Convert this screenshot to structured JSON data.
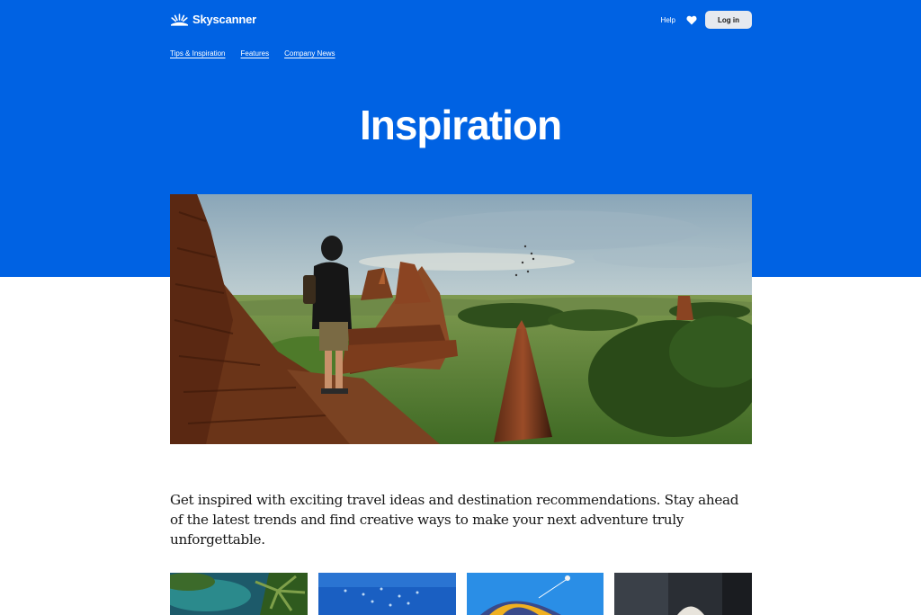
{
  "header": {
    "brand": "Skyscanner",
    "help_label": "Help",
    "login_label": "Log in"
  },
  "subnav": {
    "items": [
      {
        "label": "Tips & Inspiration"
      },
      {
        "label": "Features"
      },
      {
        "label": "Company News"
      }
    ]
  },
  "page": {
    "title": "Inspiration",
    "intro": "Get inspired with exciting travel ideas and destination recommendations. Stay ahead of the latest trends and find creative ways to make your next adventure truly unforgettable."
  },
  "colors": {
    "brand_blue": "#0062e3",
    "login_bg": "#e6e9ef",
    "text_dark": "#161616"
  },
  "icons": {
    "logo": "skyscanner-sunrise-icon",
    "favourites": "heart-icon"
  },
  "images": {
    "hero": "traveller-overlooking-temples-photo",
    "cards": [
      "tropical-lagoon-photo",
      "underwater-fish-photo",
      "paraglider-photo",
      "person-portrait-photo"
    ]
  }
}
